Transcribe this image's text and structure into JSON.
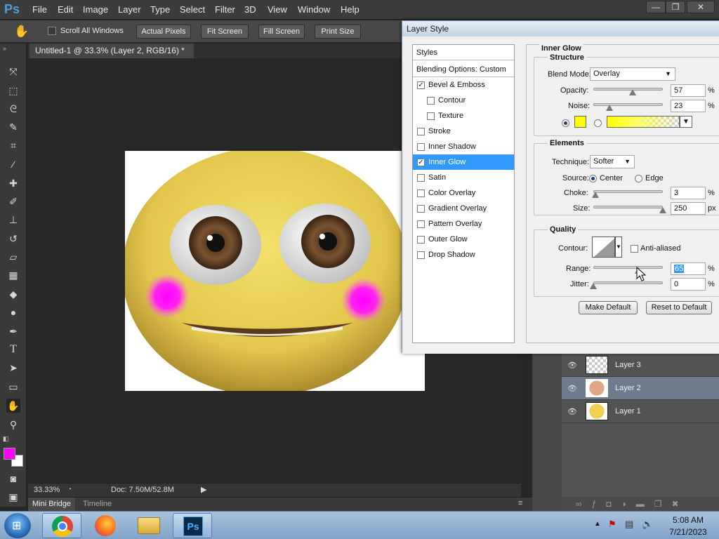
{
  "app": {
    "logo": "Ps",
    "menu": [
      "File",
      "Edit",
      "Image",
      "Layer",
      "Type",
      "Select",
      "Filter",
      "3D",
      "View",
      "Window",
      "Help"
    ],
    "window_controls": [
      "—",
      "❐",
      "✕"
    ]
  },
  "options_bar": {
    "scroll_all_windows": "Scroll All Windows",
    "buttons": [
      "Actual Pixels",
      "Fit Screen",
      "Fill Screen",
      "Print Size"
    ]
  },
  "document": {
    "tab_title": "Untitled-1 @ 33.3% (Layer 2, RGB/16) *",
    "tab_close": "×",
    "zoom": "33.33%",
    "doc_size": "Doc: 7.50M/52.8M"
  },
  "bottom_tabs": [
    "Mini Bridge",
    "Timeline"
  ],
  "colors": {
    "foreground": "#ff00ff",
    "background": "#ffffff",
    "glow": "#ffff00",
    "selection": "#3399ff"
  },
  "layers": [
    {
      "name": "Layer 3",
      "active": false
    },
    {
      "name": "Layer 2",
      "active": true
    },
    {
      "name": "Layer 1",
      "active": false
    }
  ],
  "layer_style": {
    "title": "Layer Style",
    "styles_header": "Styles",
    "blending": "Blending Options: Custom",
    "effects": [
      {
        "label": "Bevel & Emboss",
        "checked": true
      },
      {
        "label": "Contour",
        "checked": false
      },
      {
        "label": "Texture",
        "checked": false
      },
      {
        "label": "Stroke",
        "checked": false
      },
      {
        "label": "Inner Shadow",
        "checked": false
      },
      {
        "label": "Inner Glow",
        "checked": true
      },
      {
        "label": "Satin",
        "checked": false
      },
      {
        "label": "Color Overlay",
        "checked": false
      },
      {
        "label": "Gradient Overlay",
        "checked": false
      },
      {
        "label": "Pattern Overlay",
        "checked": false
      },
      {
        "label": "Outer Glow",
        "checked": false
      },
      {
        "label": "Drop Shadow",
        "checked": false
      }
    ],
    "inner_glow": {
      "section_title": "Inner Glow",
      "structure": {
        "title": "Structure",
        "blend_mode_label": "Blend Mode:",
        "blend_mode": "Overlay",
        "opacity_label": "Opacity:",
        "opacity": "57",
        "opacity_fraction": 0.57,
        "noise_label": "Noise:",
        "noise": "23",
        "noise_fraction": 0.23,
        "percent": "%"
      },
      "elements": {
        "title": "Elements",
        "technique_label": "Technique:",
        "technique": "Softer",
        "source_label": "Source:",
        "center": "Center",
        "edge": "Edge",
        "choke_label": "Choke:",
        "choke": "3",
        "choke_fraction": 0.03,
        "size_label": "Size:",
        "size": "250",
        "size_fraction": 1.0,
        "px": "px"
      },
      "quality": {
        "title": "Quality",
        "contour_label": "Contour:",
        "anti_aliased": "Anti-aliased",
        "range_label": "Range:",
        "range": "65",
        "range_fraction": 0.65,
        "jitter_label": "Jitter:",
        "jitter": "0",
        "jitter_fraction": 0.0
      },
      "make_default": "Make Default",
      "reset_default": "Reset to Default"
    }
  },
  "taskbar": {
    "time": "5:08 AM",
    "date": "7/21/2023",
    "apps": [
      "chrome-icon",
      "firefox-icon",
      "explorer-icon",
      "photoshop-icon"
    ],
    "ps_label": "Ps"
  }
}
